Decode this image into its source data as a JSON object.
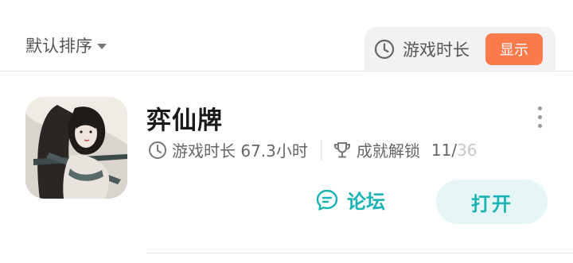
{
  "filter": {
    "sort_label": "默认排序",
    "play_time_label": "游戏时长",
    "show_label": "显示"
  },
  "game": {
    "title": "弈仙牌",
    "play_time_text": "游戏时长 67.3小时",
    "achievement_label": "成就解锁",
    "achievement_unlocked": "11/",
    "achievement_total": "36",
    "forum_label": "论坛",
    "open_label": "打开"
  },
  "colors": {
    "accent": "#19b3b3",
    "show_button": "#fb7a4c"
  }
}
